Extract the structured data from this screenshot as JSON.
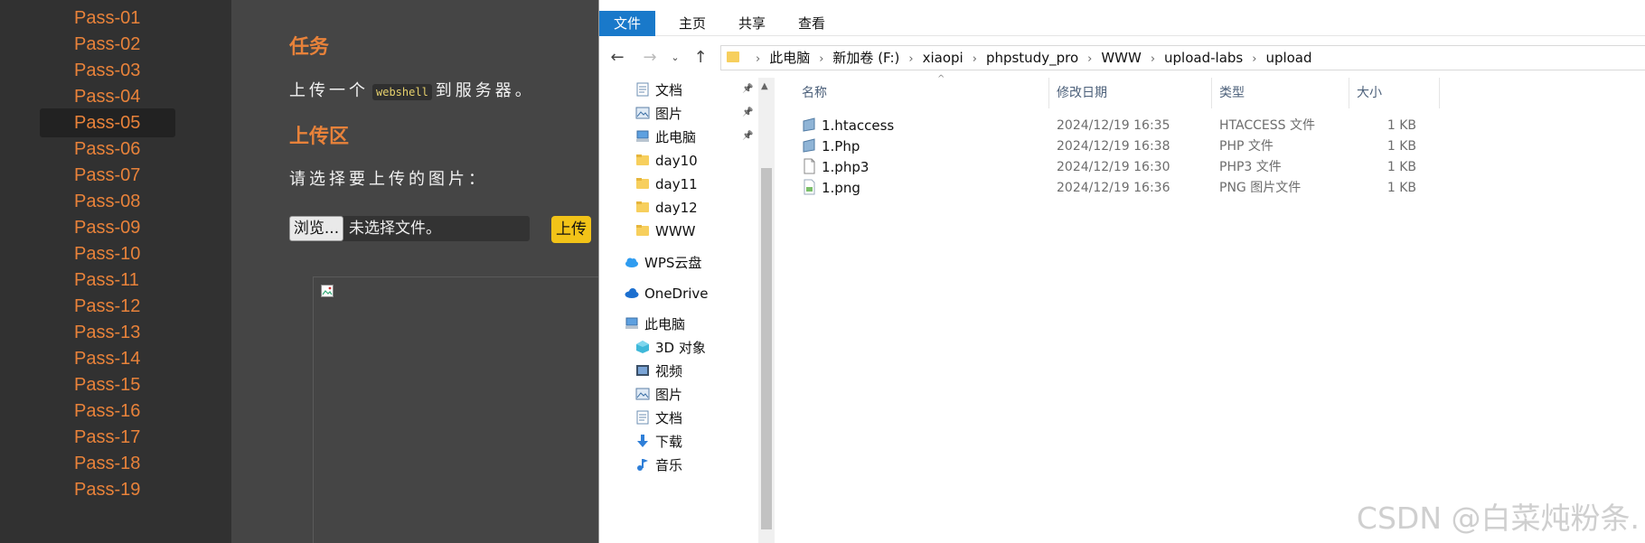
{
  "web": {
    "passes": [
      "Pass-01",
      "Pass-02",
      "Pass-03",
      "Pass-04",
      "Pass-05",
      "Pass-06",
      "Pass-07",
      "Pass-08",
      "Pass-09",
      "Pass-10",
      "Pass-11",
      "Pass-12",
      "Pass-13",
      "Pass-14",
      "Pass-15",
      "Pass-16",
      "Pass-17",
      "Pass-18",
      "Pass-19"
    ],
    "active_pass": "Pass-05",
    "task_title": "任务",
    "task_prefix": "上传一个",
    "task_code": "webshell",
    "task_suffix": "到服务器。",
    "upload_title": "上传区",
    "choose_prompt": "请选择要上传的图片：",
    "browse_label": "浏览...",
    "no_file_label": "未选择文件。",
    "upload_label": "上传",
    "accent_color": "#e8823a"
  },
  "explorer": {
    "ribbon_tabs": [
      "文件",
      "主页",
      "共享",
      "查看"
    ],
    "breadcrumbs": [
      "此电脑",
      "新加卷 (F:)",
      "xiaopi",
      "phpstudy_pro",
      "WWW",
      "upload-labs",
      "upload"
    ],
    "nav_items": [
      {
        "label": "文档",
        "icon": "documents-icon",
        "pinned": true
      },
      {
        "label": "图片",
        "icon": "pictures-icon",
        "pinned": true
      },
      {
        "label": "此电脑",
        "icon": "computer-icon",
        "pinned": true
      },
      {
        "label": "day10",
        "icon": "folder-icon",
        "pinned": false
      },
      {
        "label": "day11",
        "icon": "folder-icon",
        "pinned": false
      },
      {
        "label": "day12",
        "icon": "folder-icon",
        "pinned": false
      },
      {
        "label": "WWW",
        "icon": "folder-icon",
        "pinned": false
      },
      {
        "label": "WPS云盘",
        "icon": "cloud-icon",
        "pinned": false
      },
      {
        "label": "OneDrive",
        "icon": "onedrive-icon",
        "pinned": false
      },
      {
        "label": "此电脑",
        "icon": "computer-icon",
        "pinned": false
      },
      {
        "label": "3D 对象",
        "icon": "3d-objects-icon",
        "pinned": false
      },
      {
        "label": "视频",
        "icon": "videos-icon",
        "pinned": false
      },
      {
        "label": "图片",
        "icon": "pictures-icon",
        "pinned": false
      },
      {
        "label": "文档",
        "icon": "documents-icon",
        "pinned": false
      },
      {
        "label": "下载",
        "icon": "downloads-icon",
        "pinned": false
      },
      {
        "label": "音乐",
        "icon": "music-icon",
        "pinned": false
      }
    ],
    "columns": [
      "名称",
      "修改日期",
      "类型",
      "大小"
    ],
    "files": [
      {
        "name": "1.htaccess",
        "date": "2024/12/19 16:35",
        "type": "HTACCESS 文件",
        "size": "1 KB",
        "icon": "htaccess-file-icon"
      },
      {
        "name": "1.Php",
        "date": "2024/12/19 16:38",
        "type": "PHP 文件",
        "size": "1 KB",
        "icon": "php-file-icon"
      },
      {
        "name": "1.php3",
        "date": "2024/12/19 16:30",
        "type": "PHP3 文件",
        "size": "1 KB",
        "icon": "blank-file-icon"
      },
      {
        "name": "1.png",
        "date": "2024/12/19 16:36",
        "type": "PNG 图片文件",
        "size": "1 KB",
        "icon": "png-file-icon"
      }
    ],
    "accent_color": "#1979ca"
  },
  "watermark": "CSDN @白菜炖粉条."
}
